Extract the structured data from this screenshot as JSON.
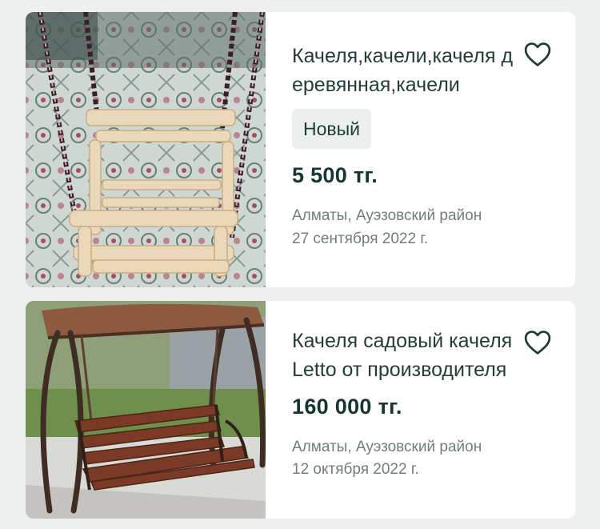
{
  "listings": [
    {
      "title": "Качеля,качели,качеля деревянная,качели",
      "badge": "Новый",
      "price": "5 500 тг.",
      "location": "Алматы, Ауэзовский район",
      "date": "27 сентября 2022 г.",
      "favorite_icon": "heart-outline-icon"
    },
    {
      "title": "Качеля садовый качеля Letto от производителя",
      "price": "160 000 тг.",
      "location": "Алматы, Ауэзовский район",
      "date": "12 октября 2022 г.",
      "favorite_icon": "heart-outline-icon"
    }
  ],
  "colors": {
    "background": "#eef0ef",
    "card": "#ffffff",
    "text": "#223e3a",
    "muted": "#6f7e7b",
    "badge_bg": "#ebefee"
  }
}
